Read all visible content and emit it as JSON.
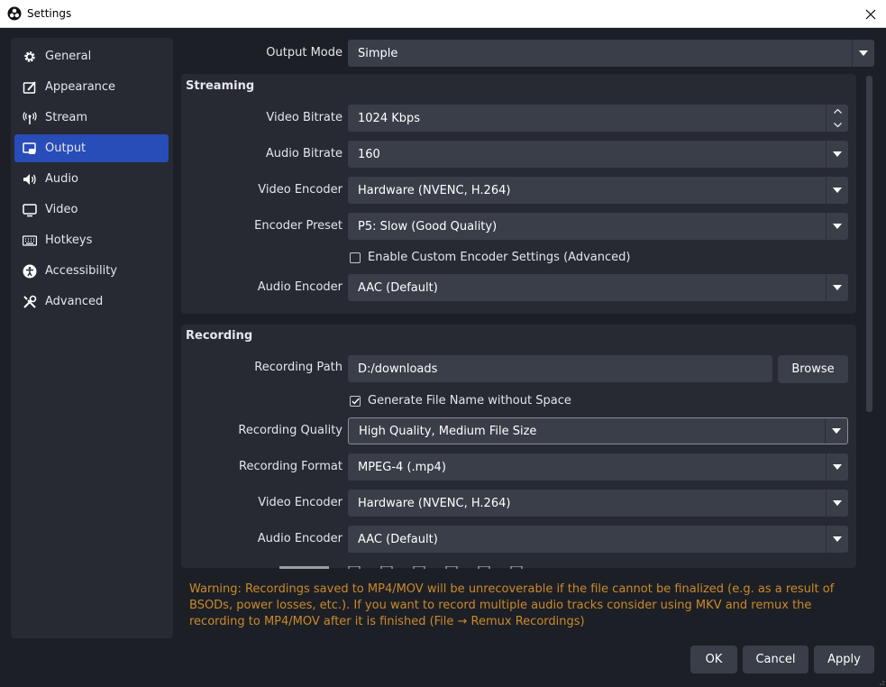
{
  "window": {
    "title": "Settings"
  },
  "sidebar": {
    "items": [
      {
        "label": "General",
        "icon": "gear-icon"
      },
      {
        "label": "Appearance",
        "icon": "appearance-icon"
      },
      {
        "label": "Stream",
        "icon": "antenna-icon"
      },
      {
        "label": "Output",
        "icon": "output-icon",
        "active": true
      },
      {
        "label": "Audio",
        "icon": "speaker-icon"
      },
      {
        "label": "Video",
        "icon": "monitor-icon"
      },
      {
        "label": "Hotkeys",
        "icon": "keyboard-icon"
      },
      {
        "label": "Accessibility",
        "icon": "accessibility-icon"
      },
      {
        "label": "Advanced",
        "icon": "tools-icon"
      }
    ]
  },
  "output_mode": {
    "label": "Output Mode",
    "value": "Simple"
  },
  "streaming": {
    "title": "Streaming",
    "video_bitrate": {
      "label": "Video Bitrate",
      "value": "1024 Kbps"
    },
    "audio_bitrate": {
      "label": "Audio Bitrate",
      "value": "160"
    },
    "video_encoder": {
      "label": "Video Encoder",
      "value": "Hardware (NVENC, H.264)"
    },
    "encoder_preset": {
      "label": "Encoder Preset",
      "value": "P5: Slow (Good Quality)"
    },
    "custom_encoder": {
      "label": "Enable Custom Encoder Settings (Advanced)",
      "checked": false
    },
    "audio_encoder": {
      "label": "Audio Encoder",
      "value": "AAC (Default)"
    }
  },
  "recording": {
    "title": "Recording",
    "path": {
      "label": "Recording Path",
      "value": "D:/downloads"
    },
    "browse_label": "Browse",
    "no_space": {
      "label": "Generate File Name without Space",
      "checked": true
    },
    "quality": {
      "label": "Recording Quality",
      "value": "High Quality, Medium File Size"
    },
    "format": {
      "label": "Recording Format",
      "value": "MPEG-4 (.mp4)"
    },
    "video_encoder": {
      "label": "Video Encoder",
      "value": "Hardware (NVENC, H.264)"
    },
    "audio_encoder": {
      "label": "Audio Encoder",
      "value": "AAC (Default)"
    }
  },
  "warning": "Warning: Recordings saved to MP4/MOV will be unrecoverable if the file cannot be finalized (e.g. as a result of BSODs, power losses, etc.). If you want to record multiple audio tracks consider using MKV and remux the recording to MP4/MOV after it is finished (File → Remux Recordings)",
  "buttons": {
    "ok": "OK",
    "cancel": "Cancel",
    "apply": "Apply"
  },
  "colors": {
    "accent": "#284cb8",
    "warning": "#c88a2a",
    "background": "#1d1f26",
    "panel": "#272a33",
    "field": "#3a3e48"
  }
}
